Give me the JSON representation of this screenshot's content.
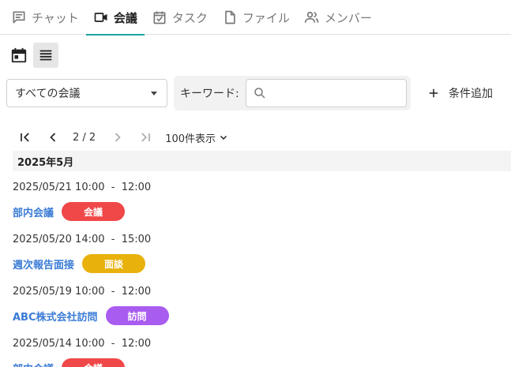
{
  "tabs": [
    {
      "label": "チャット",
      "icon": "chat-icon"
    },
    {
      "label": "会議",
      "icon": "video-camera-icon",
      "active": true
    },
    {
      "label": "タスク",
      "icon": "task-calendar-check-icon"
    },
    {
      "label": "ファイル",
      "icon": "file-icon"
    },
    {
      "label": "メンバー",
      "icon": "people-icon"
    }
  ],
  "view_toggle": {
    "calendar_icon": "calendar-icon",
    "list_icon": "list-icon",
    "active": "list"
  },
  "filter": {
    "selected": "すべての会議"
  },
  "keyword": {
    "label": "キーワード:",
    "placeholder": ""
  },
  "add_condition": {
    "label": "条件追加"
  },
  "pager": {
    "page_info": "2 / 2",
    "per_page": "100件表示"
  },
  "month_header": "2025年5月",
  "meetings": [
    {
      "time": "2025/05/21 10:00  -  12:00",
      "title": "部内会議",
      "badge": "会議",
      "badge_color": "#f04848"
    },
    {
      "time": "2025/05/20 14:00  -  15:00",
      "title": "週次報告面接",
      "badge": "面談",
      "badge_color": "#e8b10c"
    },
    {
      "time": "2025/05/19 10:00  -  12:00",
      "title": "ABC株式会社訪問",
      "badge": "訪問",
      "badge_color": "#a95cf0"
    },
    {
      "time": "2025/05/14 10:00  -  12:00",
      "title": "部内会議",
      "badge": "会議",
      "badge_color": "#f04848"
    }
  ],
  "colors": {
    "accent": "#1aa3a3",
    "link": "#3a7bd5"
  }
}
